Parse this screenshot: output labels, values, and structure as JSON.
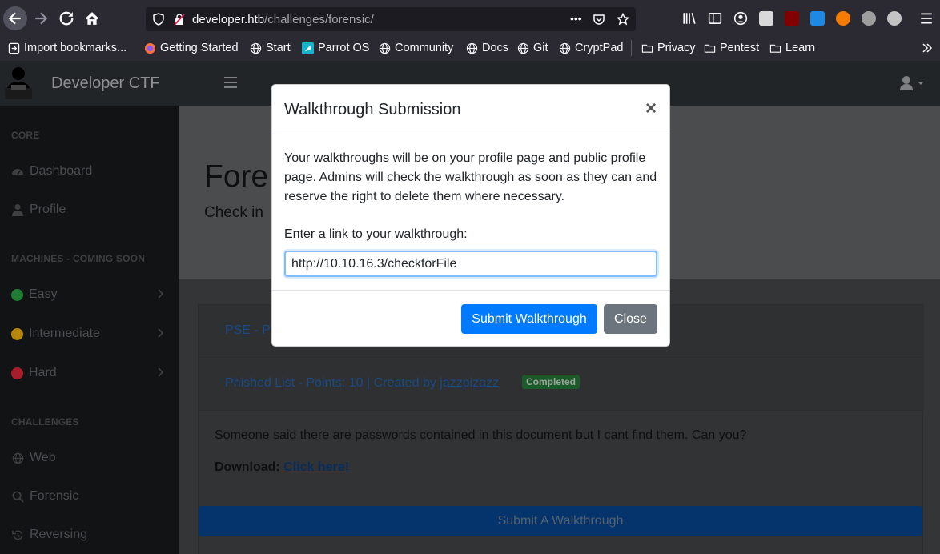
{
  "browser": {
    "url_host": "developer.htb",
    "url_path": "/challenges/forensic/",
    "url_more": "•••",
    "bookmarks": [
      {
        "label": "Import bookmarks...",
        "icon": "import-icon"
      },
      {
        "label": "Getting Started",
        "icon": "firefox-icon"
      },
      {
        "label": "Start",
        "icon": "globe-icon"
      },
      {
        "label": "Parrot OS",
        "icon": "parrot-icon"
      },
      {
        "label": "Community",
        "icon": "globe-icon"
      },
      {
        "label": "Docs",
        "icon": "globe-icon"
      },
      {
        "label": "Git",
        "icon": "globe-icon"
      },
      {
        "label": "CryptPad",
        "icon": "globe-icon"
      },
      {
        "label": "Privacy",
        "icon": "folder-icon"
      },
      {
        "label": "Pentest",
        "icon": "folder-icon"
      },
      {
        "label": "Learn",
        "icon": "folder-icon"
      }
    ]
  },
  "topnav": {
    "brand": "Developer CTF"
  },
  "sidebar": {
    "core_heading": "CORE",
    "dashboard": "Dashboard",
    "profile": "Profile",
    "machines_heading": "MACHINES - COMING SOON",
    "easy": "Easy",
    "intermediate": "Intermediate",
    "hard": "Hard",
    "challenges_heading": "CHALLENGES",
    "web": "Web",
    "forensic": "Forensic",
    "reversing": "Reversing"
  },
  "hero": {
    "title": "Fore",
    "subtitle": "Check in"
  },
  "cards": {
    "pse_link": "PSE - P",
    "phished_link": "Phished List - Points: 10 | Created by jazzpizazz",
    "phished_badge": "Completed",
    "phished_desc": "Someone said there are passwords contained in this document but I cant find them. Can you?",
    "download_label": "Download: ",
    "download_link": "Click here!",
    "submit_walkthrough": "Submit A Walkthrough"
  },
  "modal": {
    "title": "Walkthrough Submission",
    "close_symbol": "×",
    "body": "Your walkthroughs will be on your profile page and public profile page. Admins will check the walkthrough as soon as they can and reserve the right to delete them where necessary.",
    "label": "Enter a link to your walkthrough:",
    "input_value": "http://10.10.16.3/checkforFile",
    "submit_button": "Submit Walkthrough",
    "close_button": "Close"
  },
  "colors": {
    "primary": "#007bff",
    "secondary": "#6c757d",
    "focus_border": "#80bdff",
    "sidebar_bg": "#121314",
    "easy_dot": "#1e7e34",
    "intermediate_dot": "#b8860b",
    "hard_dot": "#a71d2a"
  }
}
